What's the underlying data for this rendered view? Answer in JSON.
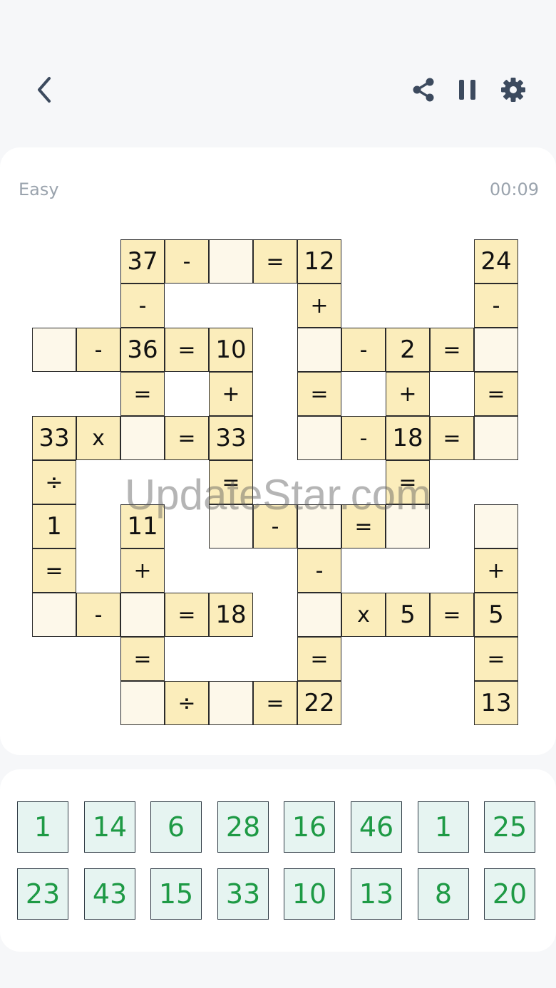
{
  "header": {
    "back_icon": "chevron-left-icon",
    "share_icon": "share-icon",
    "pause_icon": "pause-icon",
    "settings_icon": "gear-icon",
    "icon_color": "#3c4a5e"
  },
  "status": {
    "difficulty": "Easy",
    "timer": "00:09"
  },
  "colors": {
    "given_cell": "#fbedbb",
    "blank_cell": "#fdf8ea",
    "tile_bg": "#e6f4f1",
    "tile_text": "#1e9a45"
  },
  "watermark": "UpdateStar.com",
  "grid": {
    "rows": 11,
    "cols": 11,
    "cells": [
      {
        "r": 0,
        "c": 2,
        "v": "37"
      },
      {
        "r": 0,
        "c": 3,
        "v": "-"
      },
      {
        "r": 0,
        "c": 4,
        "v": ""
      },
      {
        "r": 0,
        "c": 5,
        "v": "="
      },
      {
        "r": 0,
        "c": 6,
        "v": "12"
      },
      {
        "r": 0,
        "c": 10,
        "v": "24"
      },
      {
        "r": 1,
        "c": 2,
        "v": "-"
      },
      {
        "r": 1,
        "c": 6,
        "v": "+"
      },
      {
        "r": 1,
        "c": 10,
        "v": "-"
      },
      {
        "r": 2,
        "c": 0,
        "v": ""
      },
      {
        "r": 2,
        "c": 1,
        "v": "-"
      },
      {
        "r": 2,
        "c": 2,
        "v": "36"
      },
      {
        "r": 2,
        "c": 3,
        "v": "="
      },
      {
        "r": 2,
        "c": 4,
        "v": "10"
      },
      {
        "r": 2,
        "c": 6,
        "v": ""
      },
      {
        "r": 2,
        "c": 7,
        "v": "-"
      },
      {
        "r": 2,
        "c": 8,
        "v": "2"
      },
      {
        "r": 2,
        "c": 9,
        "v": "="
      },
      {
        "r": 2,
        "c": 10,
        "v": ""
      },
      {
        "r": 3,
        "c": 2,
        "v": "="
      },
      {
        "r": 3,
        "c": 4,
        "v": "+"
      },
      {
        "r": 3,
        "c": 6,
        "v": "="
      },
      {
        "r": 3,
        "c": 8,
        "v": "+"
      },
      {
        "r": 3,
        "c": 10,
        "v": "="
      },
      {
        "r": 4,
        "c": 0,
        "v": "33"
      },
      {
        "r": 4,
        "c": 1,
        "v": "x"
      },
      {
        "r": 4,
        "c": 2,
        "v": ""
      },
      {
        "r": 4,
        "c": 3,
        "v": "="
      },
      {
        "r": 4,
        "c": 4,
        "v": "33"
      },
      {
        "r": 4,
        "c": 6,
        "v": ""
      },
      {
        "r": 4,
        "c": 7,
        "v": "-"
      },
      {
        "r": 4,
        "c": 8,
        "v": "18"
      },
      {
        "r": 4,
        "c": 9,
        "v": "="
      },
      {
        "r": 4,
        "c": 10,
        "v": ""
      },
      {
        "r": 5,
        "c": 0,
        "v": "÷"
      },
      {
        "r": 5,
        "c": 4,
        "v": "="
      },
      {
        "r": 5,
        "c": 8,
        "v": "="
      },
      {
        "r": 6,
        "c": 0,
        "v": "1"
      },
      {
        "r": 6,
        "c": 2,
        "v": "11"
      },
      {
        "r": 6,
        "c": 4,
        "v": ""
      },
      {
        "r": 6,
        "c": 5,
        "v": "-"
      },
      {
        "r": 6,
        "c": 6,
        "v": ""
      },
      {
        "r": 6,
        "c": 7,
        "v": "="
      },
      {
        "r": 6,
        "c": 8,
        "v": ""
      },
      {
        "r": 6,
        "c": 10,
        "v": ""
      },
      {
        "r": 7,
        "c": 0,
        "v": "="
      },
      {
        "r": 7,
        "c": 2,
        "v": "+"
      },
      {
        "r": 7,
        "c": 6,
        "v": "-"
      },
      {
        "r": 7,
        "c": 10,
        "v": "+"
      },
      {
        "r": 8,
        "c": 0,
        "v": ""
      },
      {
        "r": 8,
        "c": 1,
        "v": "-"
      },
      {
        "r": 8,
        "c": 2,
        "v": ""
      },
      {
        "r": 8,
        "c": 3,
        "v": "="
      },
      {
        "r": 8,
        "c": 4,
        "v": "18"
      },
      {
        "r": 8,
        "c": 6,
        "v": ""
      },
      {
        "r": 8,
        "c": 7,
        "v": "x"
      },
      {
        "r": 8,
        "c": 8,
        "v": "5"
      },
      {
        "r": 8,
        "c": 9,
        "v": "="
      },
      {
        "r": 8,
        "c": 10,
        "v": "5"
      },
      {
        "r": 9,
        "c": 2,
        "v": "="
      },
      {
        "r": 9,
        "c": 6,
        "v": "="
      },
      {
        "r": 9,
        "c": 10,
        "v": "="
      },
      {
        "r": 10,
        "c": 2,
        "v": ""
      },
      {
        "r": 10,
        "c": 3,
        "v": "÷"
      },
      {
        "r": 10,
        "c": 4,
        "v": ""
      },
      {
        "r": 10,
        "c": 5,
        "v": "="
      },
      {
        "r": 10,
        "c": 6,
        "v": "22"
      },
      {
        "r": 10,
        "c": 10,
        "v": "13"
      }
    ]
  },
  "number_tiles": [
    [
      "1",
      "14",
      "6",
      "28",
      "16",
      "46",
      "1",
      "25"
    ],
    [
      "23",
      "43",
      "15",
      "33",
      "10",
      "13",
      "8",
      "20"
    ]
  ]
}
